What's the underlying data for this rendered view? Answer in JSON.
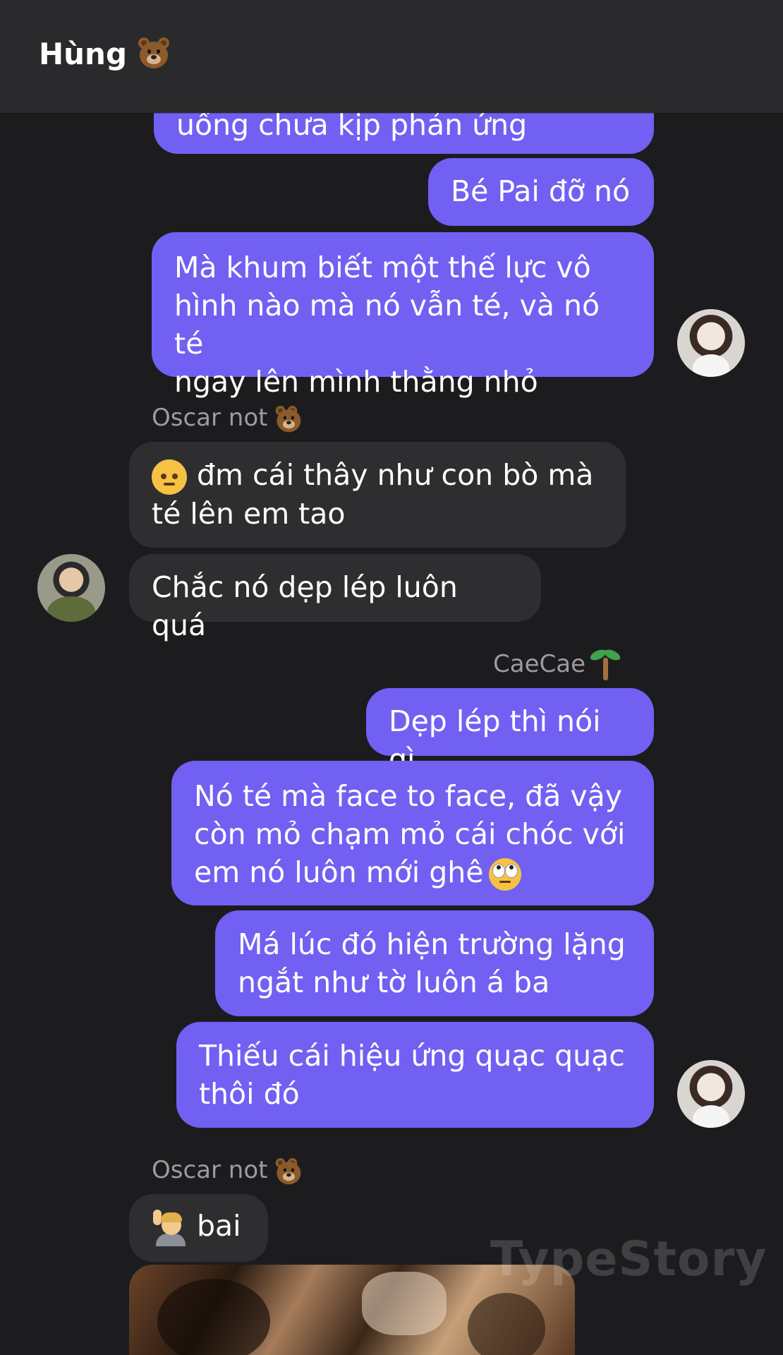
{
  "header": {
    "title": "Hùng",
    "title_icon": "bear-emoji"
  },
  "messages": [
    {
      "id": "m1",
      "side": "out",
      "text": "uống chưa kịp phản ứng"
    },
    {
      "id": "m2",
      "side": "out",
      "text": "Bé Pai đỡ nó"
    },
    {
      "id": "m3",
      "side": "out",
      "lines": [
        "Mà khum biết một thế lực vô",
        "hình nào mà nó vẫn té, và nó té",
        "ngay lên mình thằng nhỏ"
      ]
    },
    {
      "id": "s1",
      "sender": "Oscar not",
      "sender_icon": "bear-emoji"
    },
    {
      "id": "m4",
      "side": "in",
      "emoji": "angry-face-emoji",
      "lines": [
        "đm cái thây như con bò mà",
        "té lên em tao"
      ]
    },
    {
      "id": "m5",
      "side": "in",
      "text": "Chắc nó dẹp lép luôn quá"
    },
    {
      "id": "s2",
      "sender": "CaeCae",
      "sender_icon": "palm-tree-emoji"
    },
    {
      "id": "m6",
      "side": "out",
      "text": "Dẹp lép thì nói gì"
    },
    {
      "id": "m7",
      "side": "out",
      "lines": [
        "Nó té mà face to face, đã vậy",
        "còn mỏ chạm mỏ cái chóc với",
        "em nó luôn mới ghê"
      ],
      "trailing_emoji": "face-with-rolling-eyes-emoji"
    },
    {
      "id": "m8",
      "side": "out",
      "lines": [
        "Má lúc đó hiện trường lặng",
        "ngắt như tờ luôn á ba"
      ]
    },
    {
      "id": "m9",
      "side": "out",
      "lines": [
        "Thiếu cái hiệu ứng quạc quạc",
        "thôi đó"
      ]
    },
    {
      "id": "s3",
      "sender": "Oscar not",
      "sender_icon": "bear-emoji"
    },
    {
      "id": "m10",
      "side": "in",
      "emoji": "person-raising-hand-emoji",
      "text": "bai"
    }
  ],
  "watermark": "TypeStory",
  "colors": {
    "outgoing_bubble": "#7260f3",
    "incoming_bubble": "#2e2e31",
    "background": "#1c1c1e",
    "header": "#2a2a2c",
    "sender_name": "#9c9c9f"
  }
}
